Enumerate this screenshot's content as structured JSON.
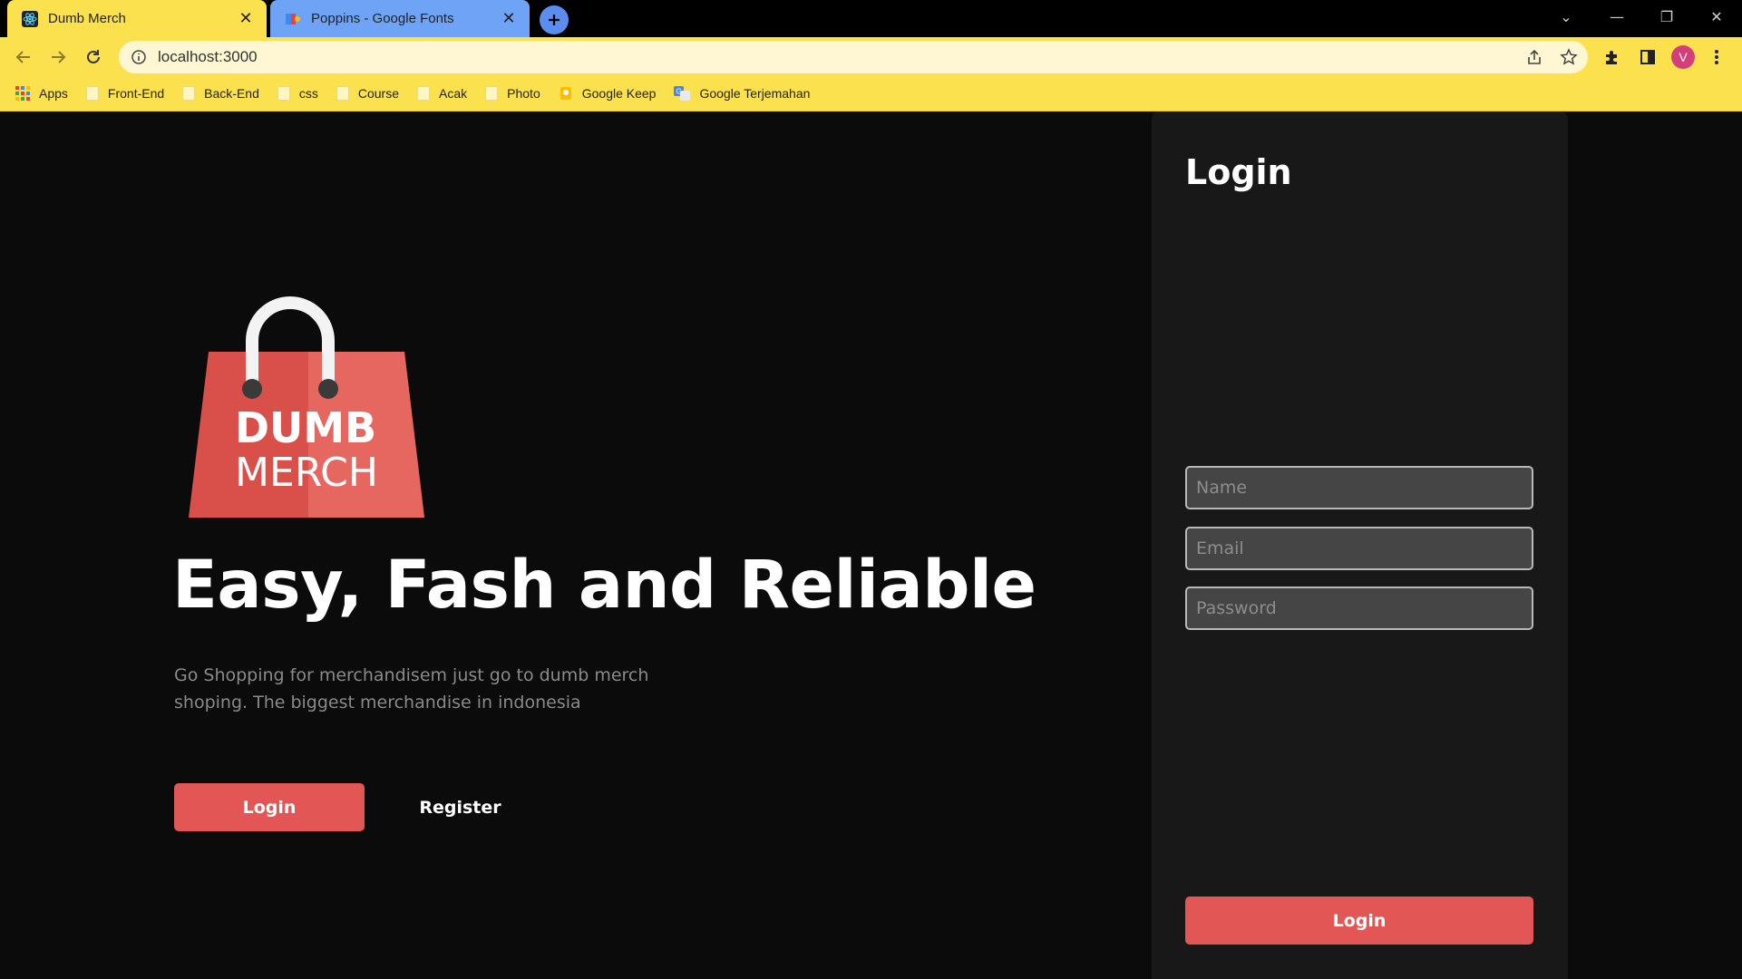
{
  "browser": {
    "tabs": [
      {
        "title": "Dumb Merch",
        "active": true,
        "favicon": "react-icon"
      },
      {
        "title": "Poppins - Google Fonts",
        "active": false,
        "favicon": "google-fonts-icon"
      }
    ],
    "address": "localhost:3000",
    "profile_initial": "V",
    "bookmarks": [
      {
        "label": "Apps",
        "icon": "apps-grid-icon"
      },
      {
        "label": "Front-End",
        "icon": "folder-icon"
      },
      {
        "label": "Back-End",
        "icon": "folder-icon"
      },
      {
        "label": "css",
        "icon": "folder-icon"
      },
      {
        "label": "Course",
        "icon": "folder-icon"
      },
      {
        "label": "Acak",
        "icon": "folder-icon"
      },
      {
        "label": "Photo",
        "icon": "folder-icon"
      },
      {
        "label": "Google Keep",
        "icon": "google-keep-icon"
      },
      {
        "label": "Google Terjemahan",
        "icon": "google-translate-icon"
      }
    ]
  },
  "hero": {
    "logo_line1": "DUMB",
    "logo_line2": "MERCH",
    "headline": "Easy, Fash and Reliable",
    "description": "Go Shopping for merchandisem just go to dumb merch shoping. The biggest merchandise in indonesia",
    "login_label": "Login",
    "register_label": "Register"
  },
  "login_form": {
    "title": "Login",
    "name_placeholder": "Name",
    "email_placeholder": "Email",
    "password_placeholder": "Password",
    "submit_label": "Login"
  },
  "colors": {
    "accent": "#e25656",
    "chrome": "#fce14f",
    "background": "#0b0b0b",
    "panel": "#181818"
  }
}
